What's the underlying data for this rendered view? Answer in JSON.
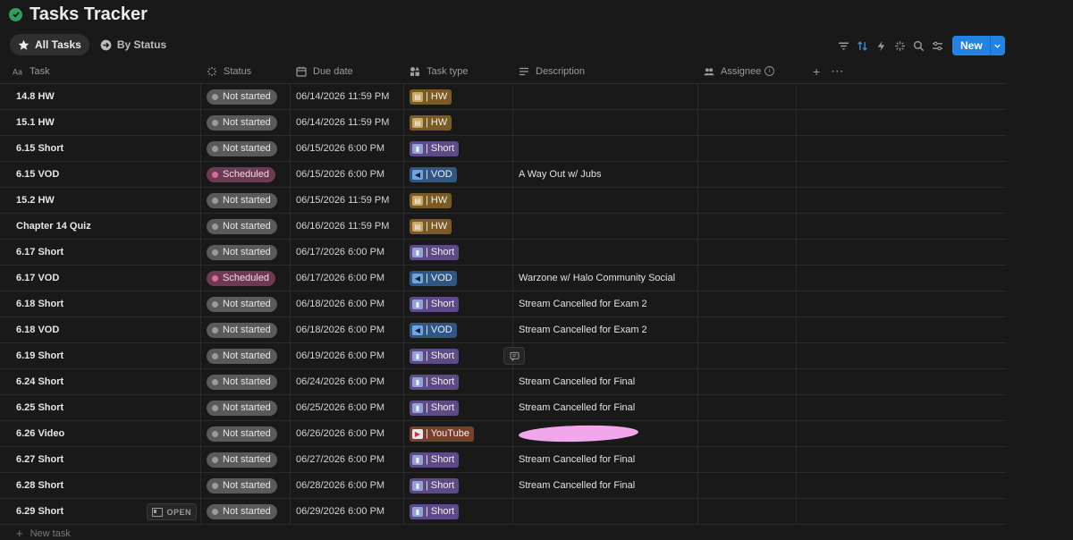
{
  "page": {
    "title": "Tasks Tracker",
    "title_icon": "check-circle-icon"
  },
  "views": [
    {
      "label": "All Tasks",
      "icon": "star-icon",
      "active": true
    },
    {
      "label": "By Status",
      "icon": "arrow-circle-icon",
      "active": false
    }
  ],
  "toolbar": {
    "icons": [
      "filter-icon",
      "sort-icon",
      "automation-icon",
      "ai-sparkle-icon",
      "search-icon",
      "settings-sliders-icon"
    ],
    "new_label": "New"
  },
  "columns": [
    {
      "key": "task",
      "label": "Task",
      "icon": "text-aa-icon"
    },
    {
      "key": "status",
      "label": "Status",
      "icon": "status-spinner-icon"
    },
    {
      "key": "due",
      "label": "Due date",
      "icon": "calendar-icon"
    },
    {
      "key": "type",
      "label": "Task type",
      "icon": "shapes-icon"
    },
    {
      "key": "desc",
      "label": "Description",
      "icon": "lines-icon"
    },
    {
      "key": "assn",
      "label": "Assignee",
      "icon": "people-icon"
    }
  ],
  "status_colors": {
    "Not started": "#5a5a5a",
    "Scheduled": "#6e3a53"
  },
  "rows": [
    {
      "task": "14.8 HW",
      "status": "Not started",
      "due": "06/14/2026 11:59 PM",
      "type": "| HW",
      "type_kind": "hw",
      "desc": ""
    },
    {
      "task": "15.1 HW",
      "status": "Not started",
      "due": "06/14/2026 11:59 PM",
      "type": "| HW",
      "type_kind": "hw",
      "desc": ""
    },
    {
      "task": "6.15 Short",
      "status": "Not started",
      "due": "06/15/2026 6:00 PM",
      "type": "| Short",
      "type_kind": "short",
      "desc": ""
    },
    {
      "task": "6.15 VOD",
      "status": "Scheduled",
      "due": "06/15/2026 6:00 PM",
      "type": "| VOD",
      "type_kind": "vod",
      "desc": "A Way Out w/ Jubs"
    },
    {
      "task": "15.2 HW",
      "status": "Not started",
      "due": "06/15/2026 11:59 PM",
      "type": "| HW",
      "type_kind": "hw",
      "desc": ""
    },
    {
      "task": "Chapter 14 Quiz",
      "status": "Not started",
      "due": "06/16/2026 11:59 PM",
      "type": "| HW",
      "type_kind": "hw",
      "desc": ""
    },
    {
      "task": "6.17 Short",
      "status": "Not started",
      "due": "06/17/2026 6:00 PM",
      "type": "| Short",
      "type_kind": "short",
      "desc": ""
    },
    {
      "task": "6.17 VOD",
      "status": "Scheduled",
      "due": "06/17/2026 6:00 PM",
      "type": "| VOD",
      "type_kind": "vod",
      "desc": "Warzone w/ Halo Community Social"
    },
    {
      "task": "6.18 Short",
      "status": "Not started",
      "due": "06/18/2026 6:00 PM",
      "type": "| Short",
      "type_kind": "short",
      "desc": "Stream Cancelled for Exam 2"
    },
    {
      "task": "6.18 VOD",
      "status": "Not started",
      "due": "06/18/2026 6:00 PM",
      "type": "| VOD",
      "type_kind": "vod",
      "desc": "Stream Cancelled for Exam 2"
    },
    {
      "task": "6.19 Short",
      "status": "Not started",
      "due": "06/19/2026 6:00 PM",
      "type": "| Short",
      "type_kind": "short",
      "desc": "",
      "comment": true
    },
    {
      "task": "6.24 Short",
      "status": "Not started",
      "due": "06/24/2026 6:00 PM",
      "type": "| Short",
      "type_kind": "short",
      "desc": "Stream Cancelled for Final"
    },
    {
      "task": "6.25 Short",
      "status": "Not started",
      "due": "06/25/2026 6:00 PM",
      "type": "| Short",
      "type_kind": "short",
      "desc": "Stream Cancelled for Final"
    },
    {
      "task": "6.26 Video",
      "status": "Not started",
      "due": "06/26/2026 6:00 PM",
      "type": "| YouTube",
      "type_kind": "yt",
      "desc": "",
      "redacted": true
    },
    {
      "task": "6.27 Short",
      "status": "Not started",
      "due": "06/27/2026 6:00 PM",
      "type": "| Short",
      "type_kind": "short",
      "desc": "Stream Cancelled for Final"
    },
    {
      "task": "6.28 Short",
      "status": "Not started",
      "due": "06/28/2026 6:00 PM",
      "type": "| Short",
      "type_kind": "short",
      "desc": "Stream Cancelled for Final"
    },
    {
      "task": "6.29 Short",
      "status": "Not started",
      "due": "06/29/2026 6:00 PM",
      "type": "| Short",
      "type_kind": "short",
      "desc": "",
      "open": true
    }
  ],
  "open_label": "OPEN",
  "new_task_label": "New task"
}
